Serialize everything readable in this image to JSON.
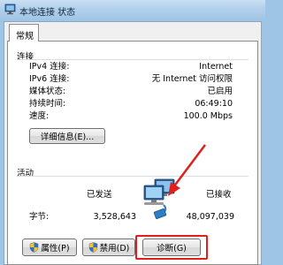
{
  "window": {
    "title": "本地连接 状态",
    "tab_label": "常规"
  },
  "connection": {
    "group_label": "连接",
    "rows": [
      {
        "label": "IPv4 连接:",
        "value": "Internet"
      },
      {
        "label": "IPv6 连接:",
        "value": "无 Internet 访问权限"
      },
      {
        "label": "媒体状态:",
        "value": "已启用"
      },
      {
        "label": "持续时间:",
        "value": "06:49:10"
      },
      {
        "label": "速度:",
        "value": "100.0 Mbps"
      }
    ],
    "details_button": "详细信息(E)..."
  },
  "activity": {
    "group_label": "活动",
    "sent_label": "已发送",
    "received_label": "已接收",
    "bytes_label": "字节:",
    "bytes_sent": "3,528,643",
    "bytes_received": "48,097,039"
  },
  "buttons": {
    "properties": "属性(P)",
    "disable": "禁用(D)",
    "diagnose": "诊断(G)"
  },
  "annotation": {
    "color": "#e0201c"
  }
}
